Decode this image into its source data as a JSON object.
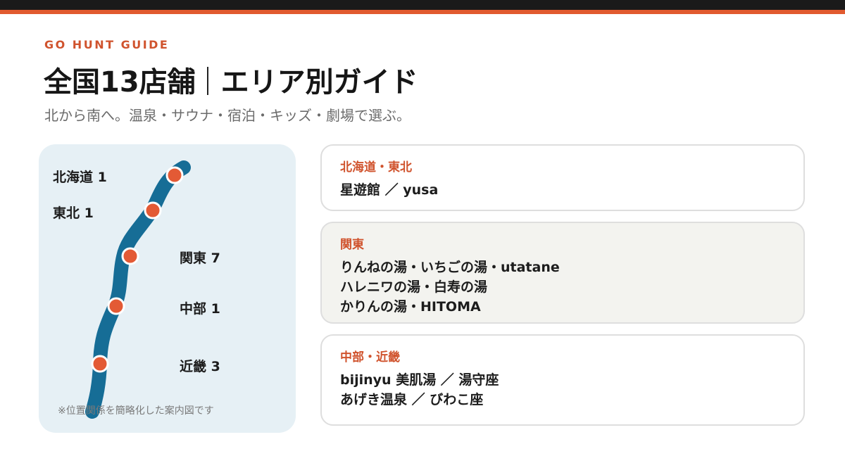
{
  "header": {
    "eyebrow": "GO HUNT GUIDE",
    "title_main": "全国13店舗",
    "title_sub": "エリア別ガイド",
    "subtitle": "北から南へ。温泉・サウナ・宿泊・キッズ・劇場で選ぶ。"
  },
  "map": {
    "labels": [
      "北海道 1",
      "東北 1",
      "関東 7",
      "中部 1",
      "近畿 3"
    ],
    "note": "※位置関係を簡略化した案内図です",
    "colors": {
      "route": "#166d96",
      "pin": "#e35a35",
      "panel": "#e6f0f5"
    }
  },
  "cards": [
    {
      "title": "北海道・東北",
      "lines": [
        "星遊館 ／ yusa"
      ]
    },
    {
      "title": "関東",
      "lines": [
        "りんねの湯・いちごの湯・utatane",
        "ハレニワの湯・白寿の湯",
        "かりんの湯・HITOMA"
      ]
    },
    {
      "title": "中部・近畿",
      "lines": [
        "bijinyu 美肌湯 ／ 湯守座",
        "あげき温泉 ／ びわこ座"
      ]
    }
  ],
  "colors": {
    "accent": "#e15a2f",
    "dark": "#1a1a1a"
  }
}
